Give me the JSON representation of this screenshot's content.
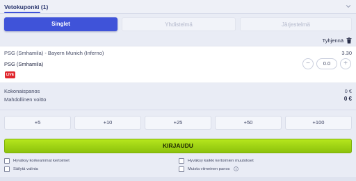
{
  "header": {
    "title": "Vetokuponki (1)",
    "chevron_icon": "chevron-down-icon"
  },
  "tabs": [
    {
      "label": "Singlet",
      "active": true
    },
    {
      "label": "Yhdistelmä",
      "active": false
    },
    {
      "label": "Järjestelmä",
      "active": false
    }
  ],
  "clear": {
    "label": "Tyhjennä",
    "icon": "trash-icon"
  },
  "bet": {
    "match": "PSG (Smhamila) - Bayern Munich (Inferno)",
    "odds": "3.30",
    "selection": "PSG (Smhamila)",
    "live_badge": "LIVE",
    "stake": {
      "minus": "−",
      "value": "0.0",
      "plus": "+"
    }
  },
  "summary": {
    "total_stake_label": "Kokonaispanos",
    "total_stake_value": "0 €",
    "potential_win_label": "Mahdollinen voitto",
    "potential_win_value": "0 €"
  },
  "quick_stakes": [
    "+5",
    "+10",
    "+25",
    "+50",
    "+100"
  ],
  "login_button": "KIRJAUDU",
  "options": {
    "accept_higher_odds": "Hyväksy korkeammat kertoimet",
    "accept_all_odds_changes": "Hyväksy kaikki kertoimien muutokset",
    "save_selection": "Säilytä valinta",
    "remember_last_stake": "Muista viimeinen panos"
  },
  "colors": {
    "accent": "#3f53d9",
    "login": "#a4d416",
    "live": "#e0262d"
  }
}
